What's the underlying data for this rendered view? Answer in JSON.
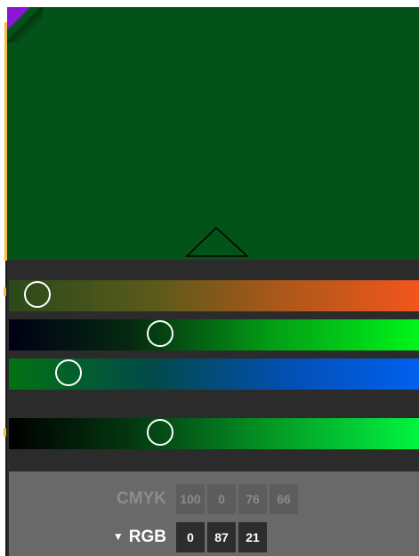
{
  "swatch": {
    "color": "#035318",
    "corner_color": "#8b17d4"
  },
  "sliders": [
    {
      "name": "slider-1",
      "level": 0.04
    },
    {
      "name": "slider-2",
      "level": 0.36
    },
    {
      "name": "slider-3",
      "level": 0.12
    },
    {
      "name": "slider-4",
      "level": 0.36
    }
  ],
  "readout": {
    "cmyk_label": "CMYK",
    "cmyk_values": [
      "100",
      "0",
      "76",
      "66"
    ],
    "rgb_label": "RGB",
    "rgb_values": [
      "0",
      "87",
      "21"
    ]
  },
  "colors": {
    "panel_bg": "#2b2b2b",
    "readout_bg": "#696969",
    "accent": "#f3bf47"
  }
}
